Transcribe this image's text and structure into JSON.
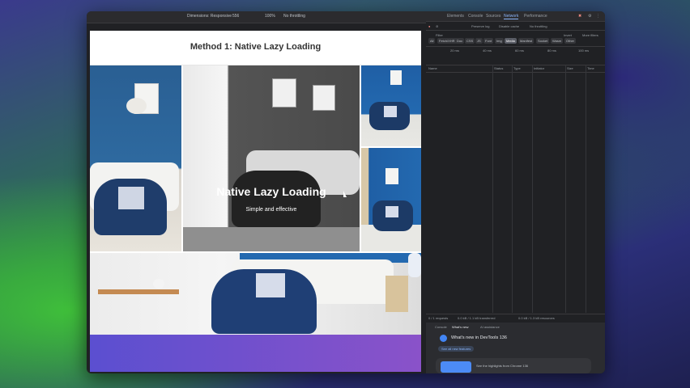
{
  "browser": {
    "device": "Dimensions: Responsive",
    "width": "556",
    "zoom": "100%",
    "throttle": "No throttling"
  },
  "page": {
    "title": "Method 1: Native Lazy Loading",
    "hero_title": "Native Lazy Loading",
    "hero_subtitle": "Simple and effective"
  },
  "devtools": {
    "tabs": [
      "Elements",
      "Console",
      "Sources",
      "Network",
      "Performance"
    ],
    "active_tab": "Network",
    "toolbar": {
      "preserve_log": "Preserve log",
      "disable_cache": "Disable cache",
      "throttle": "No throttling"
    },
    "filter_placeholder": "Filter",
    "invert": "Invert",
    "more_filters": "More filters",
    "filter_types": [
      "All",
      "Fetch/XHR",
      "Doc",
      "CSS",
      "JS",
      "Font",
      "Img",
      "Media",
      "Manifest",
      "Socket",
      "Wasm",
      "Other"
    ],
    "timeline_ticks": [
      "20 ms",
      "40 ms",
      "60 ms",
      "80 ms",
      "100 ms"
    ],
    "columns": [
      "Name",
      "Status",
      "Type",
      "Initiator",
      "Size",
      "Time"
    ],
    "status_bar": {
      "requests": "0 / 1 requests",
      "transferred": "0.0 kB / 1.1 kB transferred",
      "resources": "0.0 kB / 1.3 kB resources"
    },
    "drawer": {
      "tabs": [
        "Console",
        "What's new",
        "AI assistance"
      ],
      "heading": "What's new in DevTools 136",
      "link": "See all new features",
      "card": "See the highlights from Chrome 136"
    }
  }
}
